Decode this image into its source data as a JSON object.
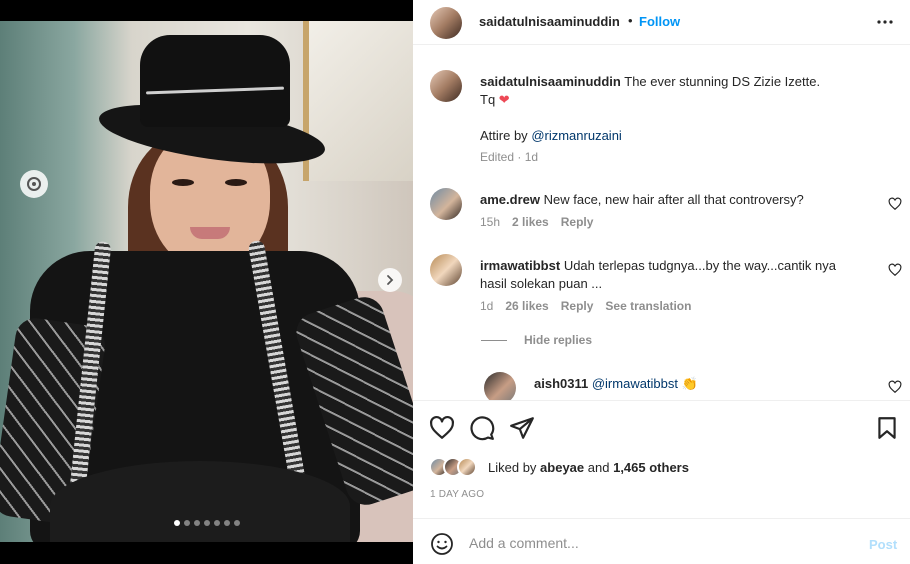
{
  "post": {
    "username": "saidatulnisaaminuddin",
    "separator": "•",
    "follow_label": "Follow",
    "media_dots_count": 7,
    "media_active_dot": 0
  },
  "caption": {
    "username": "saidatulnisaaminuddin",
    "text_line1": "The ever stunning DS Zizie Izette.",
    "text_line2": "Tq",
    "heart_emoji": "❤",
    "attire_prefix": "Attire by",
    "attire_mention": "@rizmanruzaini",
    "edited": "Edited",
    "time": "1d"
  },
  "comments": [
    {
      "username": "ame.drew",
      "text": "New face, new hair after all that controversy?",
      "time": "15h",
      "likes": "2 likes",
      "reply": "Reply"
    },
    {
      "username": "irmawatibbst",
      "text": "Udah terlepas tudgnya...by the way...cantik nya hasil solekan puan ...",
      "time": "1d",
      "likes": "26 likes",
      "reply": "Reply",
      "translate": "See translation",
      "hide_replies": "Hide replies"
    },
    {
      "username": "aish0311",
      "mention": "@irmawatibbst",
      "emoji": "👏"
    }
  ],
  "likes": {
    "prefix": "Liked by",
    "user": "abeyae",
    "and": "and",
    "count": "1,465 others"
  },
  "timestamp": "1 DAY AGO",
  "add_comment": {
    "placeholder": "Add a comment...",
    "post_label": "Post"
  },
  "colors": {
    "link_blue": "#0095f6",
    "mention": "#00376b",
    "muted": "#8e8e8e",
    "heart_red": "#ed4956",
    "post_disabled": "#b2dffc"
  }
}
